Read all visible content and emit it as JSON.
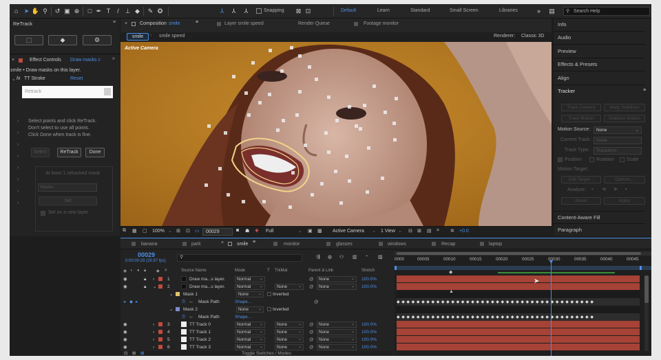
{
  "workspace": {
    "items": [
      "Default",
      "Learn",
      "Standard",
      "Small Screen",
      "Libraries"
    ],
    "active": "Default",
    "snapping_label": "Snapping",
    "search_placeholder": "Search Help"
  },
  "retrack": {
    "title": "ReTrack"
  },
  "effect_controls": {
    "tab_label": "Effect Controls",
    "tab_layer": "Draw masks c",
    "subtitle": "smile • Draw masks on this layer.",
    "fx_name": "TT Stroke",
    "reset_label": "Reset",
    "retrack_input_label": "Retrack",
    "instructions": [
      "Select points and click ReTrack.",
      "Don't select to use all points.",
      "Click Done when track is fine."
    ],
    "buttons": {
      "select": "Select",
      "retrack": "ReTrack",
      "done": "Done"
    },
    "mask_hint": "At least 1 retracked mask",
    "masks_dropdown": "Masks",
    "set_button": "Set",
    "checkbox_label": "Set on a new layer"
  },
  "composition": {
    "tab_prefix": "Composition",
    "tab_name": "smile",
    "layer_tab": "Layer smile speed",
    "render_queue": "Render Queue",
    "footage_tab": "Footage  monitor",
    "crumbs": [
      "smile",
      "smile speed"
    ],
    "renderer_label": "Renderer:",
    "renderer_value": "Classic 3D",
    "active_camera_overlay": "Active Camera",
    "footer": {
      "zoom": "100%",
      "timecode": "00029",
      "resolution": "Full",
      "camera": "Active Camera",
      "views": "1 View",
      "exposure": "+0.0"
    }
  },
  "right_panels": {
    "items": [
      "Info",
      "Audio",
      "Preview",
      "Effects & Presets",
      "Align",
      "Tracker"
    ],
    "tracker": {
      "buttons_row1": [
        "Track Camera",
        "Warp Stabilizer"
      ],
      "buttons_row2": [
        "Track Motion",
        "Stabilize Motion"
      ],
      "motion_source_label": "Motion Source:",
      "motion_source_value": "None",
      "current_track_label": "Current Track:",
      "current_track_value": "None",
      "track_type_label": "Track Type:",
      "track_type_value": "Transform",
      "checkboxes": [
        "Position",
        "Rotation",
        "Scale"
      ],
      "motion_target": "Motion Target:",
      "edit_target": "Edit Target...",
      "options": "Options...",
      "analyze": "Analyze:",
      "reset": "Reset",
      "apply": "Apply"
    },
    "bottom_items": [
      "Content-Aware Fill",
      "Paragraph"
    ]
  },
  "timeline": {
    "tabs": [
      "banana",
      "park",
      "smile",
      "monitor",
      "glasses",
      "windows",
      "Recap",
      "laptop"
    ],
    "active_tab": "smile",
    "timecode": "00029",
    "timecode_sub": "0:00:00:29 (29.97 fps)",
    "headers": {
      "source": "Source Name",
      "mode": "Mode",
      "t": "T",
      "trkmat": "TrkMat",
      "parent": "Parent & Link",
      "stretch": "Stretch"
    },
    "ruler": [
      "0000",
      "00005",
      "00010",
      "00015",
      "00020",
      "00025",
      "00030",
      "00035",
      "00040",
      "00045"
    ],
    "footer": "Toggle Switches / Modes",
    "layers": [
      {
        "num": "1",
        "name": "Draw ma...s layer.",
        "mode": "Normal",
        "trkmat": "",
        "parent": "None",
        "stretch": "100.0%",
        "color": "#1a1a1a"
      },
      {
        "num": "2",
        "name": "Draw ma...s layer.",
        "mode": "Normal",
        "trkmat": "None",
        "parent": "None",
        "stretch": "100.0%",
        "color": "#1a1a1a"
      }
    ],
    "mask1": {
      "name": "Mask 1",
      "mode": "None",
      "inverted": "Inverted",
      "path_label": "Mask Path",
      "path_value": "Shape..."
    },
    "mask2": {
      "name": "Mask 2",
      "mode": "None",
      "inverted": "Inverted",
      "path_label": "Mask Path",
      "path_value": "Shape..."
    },
    "tracks": [
      {
        "num": "3",
        "name": "TT Track 0",
        "mode": "Normal",
        "trkmat": "None",
        "parent": "None",
        "stretch": "100.0%"
      },
      {
        "num": "4",
        "name": "TT Track 1",
        "mode": "Normal",
        "trkmat": "None",
        "parent": "None",
        "stretch": "100.0%"
      },
      {
        "num": "5",
        "name": "TT Track 2",
        "mode": "Normal",
        "trkmat": "None",
        "parent": "None",
        "stretch": "100.0%"
      },
      {
        "num": "6",
        "name": "TT Track 3",
        "mode": "Normal",
        "trkmat": "None",
        "parent": "None",
        "stretch": "100.0%"
      }
    ]
  },
  "colors": {
    "accent": "#4d8fe6",
    "layer_bar": "#a64236",
    "track_label": "#c14b3e",
    "mask_outline": "#f2d48a"
  }
}
